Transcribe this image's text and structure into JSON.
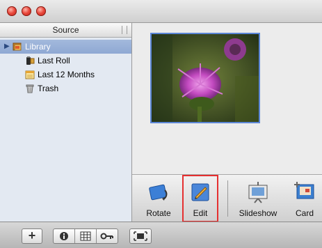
{
  "window": {
    "traffic_lights": [
      "close",
      "minimize",
      "zoom"
    ]
  },
  "sidebar": {
    "header": "Source",
    "items": [
      {
        "label": "Library",
        "icon": "library-icon",
        "selected": true
      },
      {
        "label": "Last Roll",
        "icon": "film-roll-icon"
      },
      {
        "label": "Last 12 Months",
        "icon": "calendar-icon"
      },
      {
        "label": "Trash",
        "icon": "trash-icon"
      }
    ]
  },
  "toolbar": {
    "tools": [
      {
        "label": "Rotate",
        "icon": "rotate-icon"
      },
      {
        "label": "Edit",
        "icon": "edit-icon",
        "highlighted": true
      },
      {
        "label": "Slideshow",
        "icon": "slideshow-icon"
      },
      {
        "label": "Card",
        "icon": "card-icon"
      }
    ]
  },
  "bottom_bar": {
    "add_label": "+",
    "buttons": [
      "info-icon",
      "calendar-grid-icon",
      "keyword-icon",
      "fullscreen-icon"
    ]
  },
  "colors": {
    "selection": "#8fa8d3",
    "highlight": "#e53030",
    "photo_border": "#5b86d6"
  }
}
